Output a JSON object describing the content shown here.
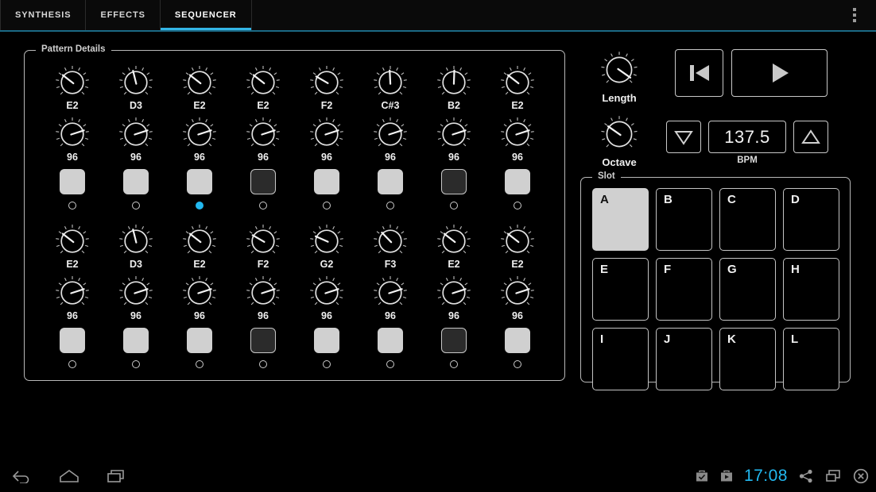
{
  "tabs": [
    {
      "label": "SYNTHESIS",
      "active": false
    },
    {
      "label": "EFFECTS",
      "active": false
    },
    {
      "label": "SEQUENCER",
      "active": true
    }
  ],
  "accent_color": "#33b5e5",
  "overflow_menu": {
    "icon": "more-vertical-icon"
  },
  "pattern_panel": {
    "legend": "Pattern Details",
    "steps": [
      {
        "note": "E2",
        "velocity": "96",
        "pad_on": true,
        "led_lit": false
      },
      {
        "note": "D3",
        "velocity": "96",
        "pad_on": true,
        "led_lit": false
      },
      {
        "note": "E2",
        "velocity": "96",
        "pad_on": true,
        "led_lit": true
      },
      {
        "note": "E2",
        "velocity": "96",
        "pad_on": false,
        "led_lit": false
      },
      {
        "note": "F2",
        "velocity": "96",
        "pad_on": true,
        "led_lit": false
      },
      {
        "note": "C#3",
        "velocity": "96",
        "pad_on": true,
        "led_lit": false
      },
      {
        "note": "B2",
        "velocity": "96",
        "pad_on": false,
        "led_lit": false
      },
      {
        "note": "E2",
        "velocity": "96",
        "pad_on": true,
        "led_lit": false
      },
      {
        "note": "E2",
        "velocity": "96",
        "pad_on": true,
        "led_lit": false
      },
      {
        "note": "D3",
        "velocity": "96",
        "pad_on": true,
        "led_lit": false
      },
      {
        "note": "E2",
        "velocity": "96",
        "pad_on": true,
        "led_lit": false
      },
      {
        "note": "F2",
        "velocity": "96",
        "pad_on": false,
        "led_lit": false
      },
      {
        "note": "G2",
        "velocity": "96",
        "pad_on": true,
        "led_lit": false
      },
      {
        "note": "F3",
        "velocity": "96",
        "pad_on": true,
        "led_lit": false
      },
      {
        "note": "E2",
        "velocity": "96",
        "pad_on": false,
        "led_lit": false
      },
      {
        "note": "E2",
        "velocity": "96",
        "pad_on": true,
        "led_lit": false
      }
    ]
  },
  "transport": {
    "length_knob_label": "Length",
    "octave_knob_label": "Octave",
    "rewind_icon": "skip-to-start-icon",
    "play_icon": "play-icon",
    "bpm_down_icon": "triangle-down-icon",
    "bpm_up_icon": "triangle-up-icon",
    "bpm_value": "137.5",
    "bpm_caption": "BPM"
  },
  "slot_panel": {
    "legend": "Slot",
    "slots": [
      {
        "label": "A",
        "selected": true
      },
      {
        "label": "B",
        "selected": false
      },
      {
        "label": "C",
        "selected": false
      },
      {
        "label": "D",
        "selected": false
      },
      {
        "label": "E",
        "selected": false
      },
      {
        "label": "F",
        "selected": false
      },
      {
        "label": "G",
        "selected": false
      },
      {
        "label": "H",
        "selected": false
      },
      {
        "label": "I",
        "selected": false
      },
      {
        "label": "J",
        "selected": false
      },
      {
        "label": "K",
        "selected": false
      },
      {
        "label": "L",
        "selected": false
      }
    ]
  },
  "system_bar": {
    "back_icon": "back-arrow-icon",
    "home_icon": "home-icon",
    "recents_icon": "recent-apps-icon",
    "briefcase_check_icon": "briefcase-check-icon",
    "briefcase_play_icon": "briefcase-play-icon",
    "clock": "17:08",
    "share_icon": "share-icon",
    "screen_icon": "multi-window-icon",
    "close_icon": "close-circle-icon"
  }
}
